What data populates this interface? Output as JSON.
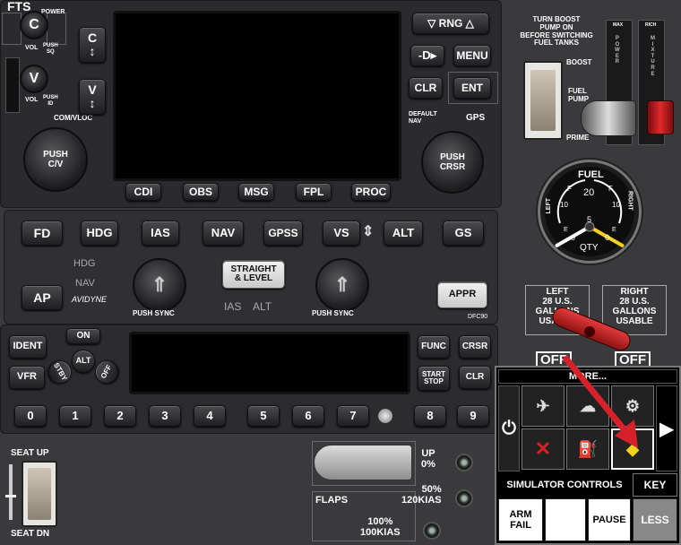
{
  "gps": {
    "fts": "FTS",
    "power": "POWER",
    "vol": "VOL",
    "push_sq": "PUSH\nSQ",
    "push_id": "PUSH\nID",
    "com_vloc": "COM/VLOC",
    "left_knob": "PUSH\nC/V",
    "right_knob": "PUSH\nCRSR",
    "default_nav": "DEFAULT\nNAV",
    "gps_label": "GPS",
    "btn_rng": "RNG",
    "btn_menu": "MENU",
    "btn_clr": "CLR",
    "btn_ent": "ENT",
    "bottom_buttons": [
      "CDI",
      "OBS",
      "MSG",
      "FPL",
      "PROC"
    ]
  },
  "autopilot": {
    "row1": [
      "FD",
      "HDG",
      "IAS",
      "NAV",
      "GPSS",
      "VS",
      "ALT",
      "GS"
    ],
    "ap": "AP",
    "hdg_nav_top": "HDG",
    "hdg_nav_bottom": "NAV",
    "avidyne": "AVIDYNE",
    "push_sync_left": "PUSH SYNC",
    "push_sync_right": "PUSH SYNC",
    "straight_level": "STRAIGHT\n& LEVEL",
    "ias_alt": "IAS    ALT",
    "appr": "APPR",
    "model": "DFC90"
  },
  "transponder": {
    "ident": "IDENT",
    "vfr": "VFR",
    "on": "ON",
    "alt": "ALT",
    "stby": "STBY",
    "off": "OFF",
    "func": "FUNC",
    "crsr": "CRSR",
    "start_stop": "START\nSTOP",
    "clr": "CLR",
    "digits": [
      "0",
      "1",
      "2",
      "3",
      "4",
      "5",
      "6",
      "7",
      "8",
      "9"
    ]
  },
  "fuel": {
    "boost_note": "TURN BOOST\nPUMP ON\nBEFORE SWITCHING\nFUEL TANKS",
    "boost": "BOOST",
    "fuel_pump": "FUEL\nPUMP",
    "prime": "PRIME",
    "power_lever": "P\nO\nW\nE\nR",
    "mixture_lever": "M\nI\nX\nT\nU\nR\nE",
    "power_top": "MAX",
    "mixture_top": "RICH",
    "gauge_title": "FUEL",
    "gauge_left": "LEFT",
    "gauge_right": "RIGHT",
    "gauge_qty": "QTY",
    "gauge_20": "20",
    "gauge_10a": "10",
    "gauge_10b": "10",
    "gauge_5": "5",
    "gauge_0a": "0",
    "gauge_0b": "0",
    "gauge_E": "E",
    "gauge_F": "F",
    "gauge_left_level": 0.05,
    "gauge_right_level": 0.05,
    "left_tank": "LEFT\n28 U.S.\nGALLONS\nUSABLE",
    "right_tank": "RIGHT\n28 U.S.\nGALLONS\nUSABLE",
    "off_left": "OFF",
    "off_right": "OFF"
  },
  "seat": {
    "up": "SEAT UP",
    "dn": "SEAT DN"
  },
  "flaps": {
    "label": "FLAPS",
    "up": "UP\n0%",
    "half": "50%\n120KIAS",
    "full": "100%\n100KIAS"
  },
  "sim_popup": {
    "more": "MORE...",
    "title": "SIMULATOR CONTROLS",
    "key": "KEY",
    "arm_fail": "ARM\nFAIL",
    "pause": "PAUSE",
    "less": "LESS"
  },
  "colors": {
    "accent_red": "#d6202a",
    "warn_yellow": "#f2d21a"
  }
}
